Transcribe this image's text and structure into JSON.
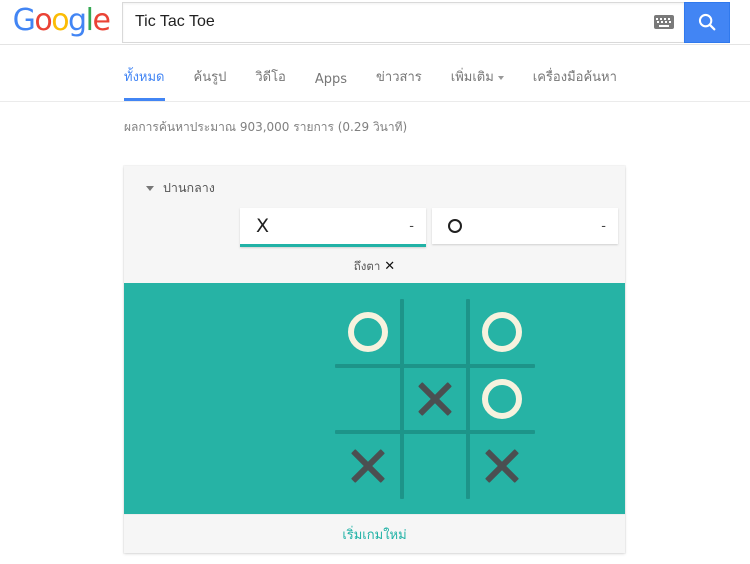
{
  "header": {
    "logo": {
      "letters": [
        {
          "char": "G",
          "color": "#4285F4"
        },
        {
          "char": "o",
          "color": "#EA4335"
        },
        {
          "char": "o",
          "color": "#FBBC05"
        },
        {
          "char": "g",
          "color": "#4285F4"
        },
        {
          "char": "l",
          "color": "#34A853"
        },
        {
          "char": "e",
          "color": "#EA4335"
        }
      ],
      "alt": "Google"
    },
    "search": {
      "value": "Tic Tac Toe",
      "placeholder": "",
      "keyboard_icon": "keyboard-icon",
      "search_icon": "search-icon"
    }
  },
  "nav": {
    "items": [
      {
        "label": "ทั้งหมด",
        "active": true,
        "has_caret": false
      },
      {
        "label": "ค้นรูป",
        "active": false,
        "has_caret": false
      },
      {
        "label": "วิดีโอ",
        "active": false,
        "has_caret": false
      },
      {
        "label": "Apps",
        "active": false,
        "has_caret": false
      },
      {
        "label": "ข่าวสาร",
        "active": false,
        "has_caret": false
      },
      {
        "label": "เพิ่มเติม",
        "active": false,
        "has_caret": true
      },
      {
        "label": "เครื่องมือค้นหา",
        "active": false,
        "has_caret": false
      }
    ]
  },
  "result_stats": "ผลการค้นหาประมาณ 903,000 รายการ (0.29 วินาที)",
  "game": {
    "difficulty": "ปานกลาง",
    "score_x": {
      "mark": "X",
      "value": "-",
      "active": true
    },
    "score_o": {
      "mark": "O",
      "value": "-",
      "active": false
    },
    "turn_label": "ถึงตา",
    "turn_mark": "✕",
    "new_game_label": "เริ่มเกมใหม่",
    "board": [
      "O",
      "",
      "O",
      "",
      "X",
      "O",
      "X",
      "",
      "X"
    ],
    "colors": {
      "board_bg": "#26b3a5",
      "grid_line": "#1d9489",
      "o_color": "#f7f2de",
      "x_color": "#4b4f51",
      "accent": "#21b2a6",
      "google_blue": "#4285f4"
    }
  }
}
